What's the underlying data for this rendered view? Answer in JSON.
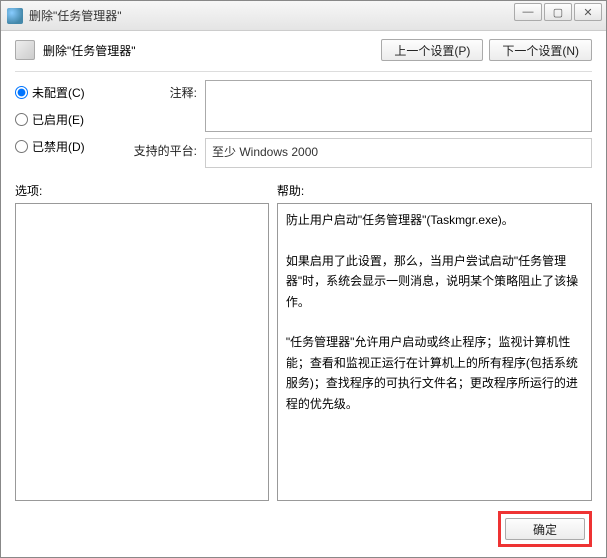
{
  "window": {
    "title": "删除\"任务管理器\""
  },
  "header": {
    "title": "删除\"任务管理器\"",
    "prev_btn": "上一个设置(P)",
    "next_btn": "下一个设置(N)"
  },
  "config": {
    "radios": {
      "not_configured": "未配置(C)",
      "enabled": "已启用(E)",
      "disabled": "已禁用(D)"
    },
    "comment_label": "注释:",
    "comment_value": "",
    "platform_label": "支持的平台:",
    "platform_value": "至少 Windows 2000"
  },
  "lower": {
    "options_label": "选项:",
    "help_label": "帮助:",
    "help_text": "防止用户启动\"任务管理器\"(Taskmgr.exe)。\n\n如果启用了此设置，那么，当用户尝试启动\"任务管理器\"时，系统会显示一则消息，说明某个策略阻止了该操作。\n\n\"任务管理器\"允许用户启动或终止程序；监视计算机性能；查看和监视正运行在计算机上的所有程序(包括系统服务)；查找程序的可执行文件名；更改程序所运行的进程的优先级。"
  },
  "footer": {
    "ok": "确定"
  }
}
